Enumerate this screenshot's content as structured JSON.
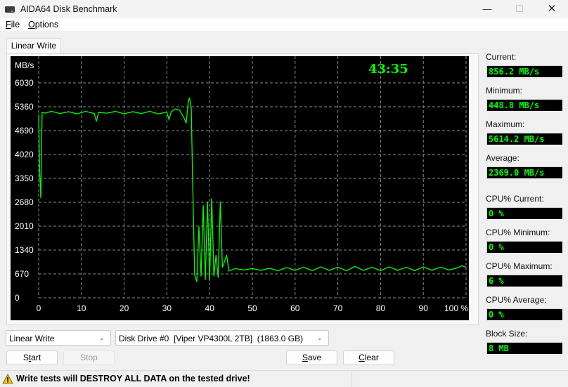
{
  "window": {
    "title": "AIDA64 Disk Benchmark",
    "controls": {
      "minimize": "—",
      "maximize": "☐",
      "close": "✕"
    }
  },
  "menu": [
    {
      "label": "File",
      "accel": "F"
    },
    {
      "label": "Options",
      "accel": "O"
    }
  ],
  "tabs": [
    {
      "label": "Linear Write",
      "active": true
    }
  ],
  "chart_data": {
    "type": "line",
    "title": "",
    "elapsed_time": "43:35",
    "ylabel": "MB/s",
    "xlabel": "%",
    "ylim": [
      0,
      6700
    ],
    "xlim": [
      0,
      100
    ],
    "y_ticks": [
      0,
      670,
      1340,
      2010,
      2680,
      3350,
      4020,
      4690,
      5360,
      6030
    ],
    "y_tick_labels": [
      "0",
      "670",
      "1340",
      "2010",
      "2680",
      "3350",
      "4020",
      "4690",
      "5360",
      "6030"
    ],
    "x_ticks": [
      0,
      10,
      20,
      30,
      40,
      50,
      60,
      70,
      80,
      90,
      100
    ],
    "x_tick_labels": [
      "0",
      "10",
      "20",
      "30",
      "40",
      "50",
      "60",
      "70",
      "80",
      "90",
      "100 %"
    ],
    "grid": true,
    "line_color": "#00ff00",
    "series": [
      {
        "name": "Linear Write",
        "points": [
          [
            0.0,
            5150
          ],
          [
            0.2,
            3700
          ],
          [
            0.5,
            2800
          ],
          [
            0.8,
            5200
          ],
          [
            1.5,
            5180
          ],
          [
            3,
            5230
          ],
          [
            5,
            5170
          ],
          [
            7,
            5220
          ],
          [
            9,
            5160
          ],
          [
            11,
            5230
          ],
          [
            13,
            5170
          ],
          [
            13.5,
            4950
          ],
          [
            14,
            5200
          ],
          [
            16,
            5180
          ],
          [
            18,
            5230
          ],
          [
            20,
            5160
          ],
          [
            22,
            5220
          ],
          [
            24,
            5170
          ],
          [
            26,
            5230
          ],
          [
            28,
            5160
          ],
          [
            30,
            5210
          ],
          [
            30.5,
            5000
          ],
          [
            31,
            5220
          ],
          [
            32,
            5300
          ],
          [
            33,
            5260
          ],
          [
            34,
            5050
          ],
          [
            34.5,
            4900
          ],
          [
            35,
            5500
          ],
          [
            35.3,
            5614
          ],
          [
            35.7,
            5300
          ],
          [
            36,
            3400
          ],
          [
            36.5,
            650
          ],
          [
            37,
            450
          ],
          [
            37.5,
            2000
          ],
          [
            38,
            600
          ],
          [
            38.5,
            2600
          ],
          [
            39,
            500
          ],
          [
            39.5,
            2700
          ],
          [
            40,
            480
          ],
          [
            40.5,
            2800
          ],
          [
            41,
            600
          ],
          [
            41.5,
            1200
          ],
          [
            42,
            560
          ],
          [
            42.5,
            2700
          ],
          [
            43,
            850
          ],
          [
            44,
            1200
          ],
          [
            44.5,
            750
          ],
          [
            46,
            820
          ],
          [
            48,
            780
          ],
          [
            50,
            820
          ],
          [
            52,
            770
          ],
          [
            54,
            830
          ],
          [
            56,
            760
          ],
          [
            58,
            850
          ],
          [
            60,
            770
          ],
          [
            62,
            860
          ],
          [
            64,
            760
          ],
          [
            66,
            870
          ],
          [
            68,
            770
          ],
          [
            70,
            860
          ],
          [
            72,
            760
          ],
          [
            74,
            880
          ],
          [
            76,
            770
          ],
          [
            78,
            860
          ],
          [
            80,
            760
          ],
          [
            82,
            870
          ],
          [
            84,
            770
          ],
          [
            86,
            860
          ],
          [
            88,
            760
          ],
          [
            90,
            870
          ],
          [
            92,
            770
          ],
          [
            94,
            860
          ],
          [
            96,
            780
          ],
          [
            98,
            840
          ],
          [
            99,
            900
          ],
          [
            100,
            856
          ]
        ]
      }
    ]
  },
  "stats": [
    {
      "label": "Current:",
      "value": "856.2 MB/s"
    },
    {
      "label": "Minimum:",
      "value": "448.8 MB/s"
    },
    {
      "label": "Maximum:",
      "value": "5614.2 MB/s"
    },
    {
      "label": "Average:",
      "value": "2369.0 MB/s"
    },
    {
      "label": "CPU% Current:",
      "value": "0 %"
    },
    {
      "label": "CPU% Minimum:",
      "value": "0 %"
    },
    {
      "label": "CPU% Maximum:",
      "value": "6 %"
    },
    {
      "label": "CPU% Average:",
      "value": "0 %"
    },
    {
      "label": "Block Size:",
      "value": "8 MB"
    }
  ],
  "controls": {
    "test_select": "Linear Write",
    "drive_select": "Disk Drive #0  [Viper VP4300L 2TB]  (1863.0 GB)",
    "start": "Start",
    "stop": "Stop",
    "save": "Save",
    "clear": "Clear"
  },
  "status": {
    "warning": "Write tests will DESTROY ALL DATA on the tested drive!"
  }
}
